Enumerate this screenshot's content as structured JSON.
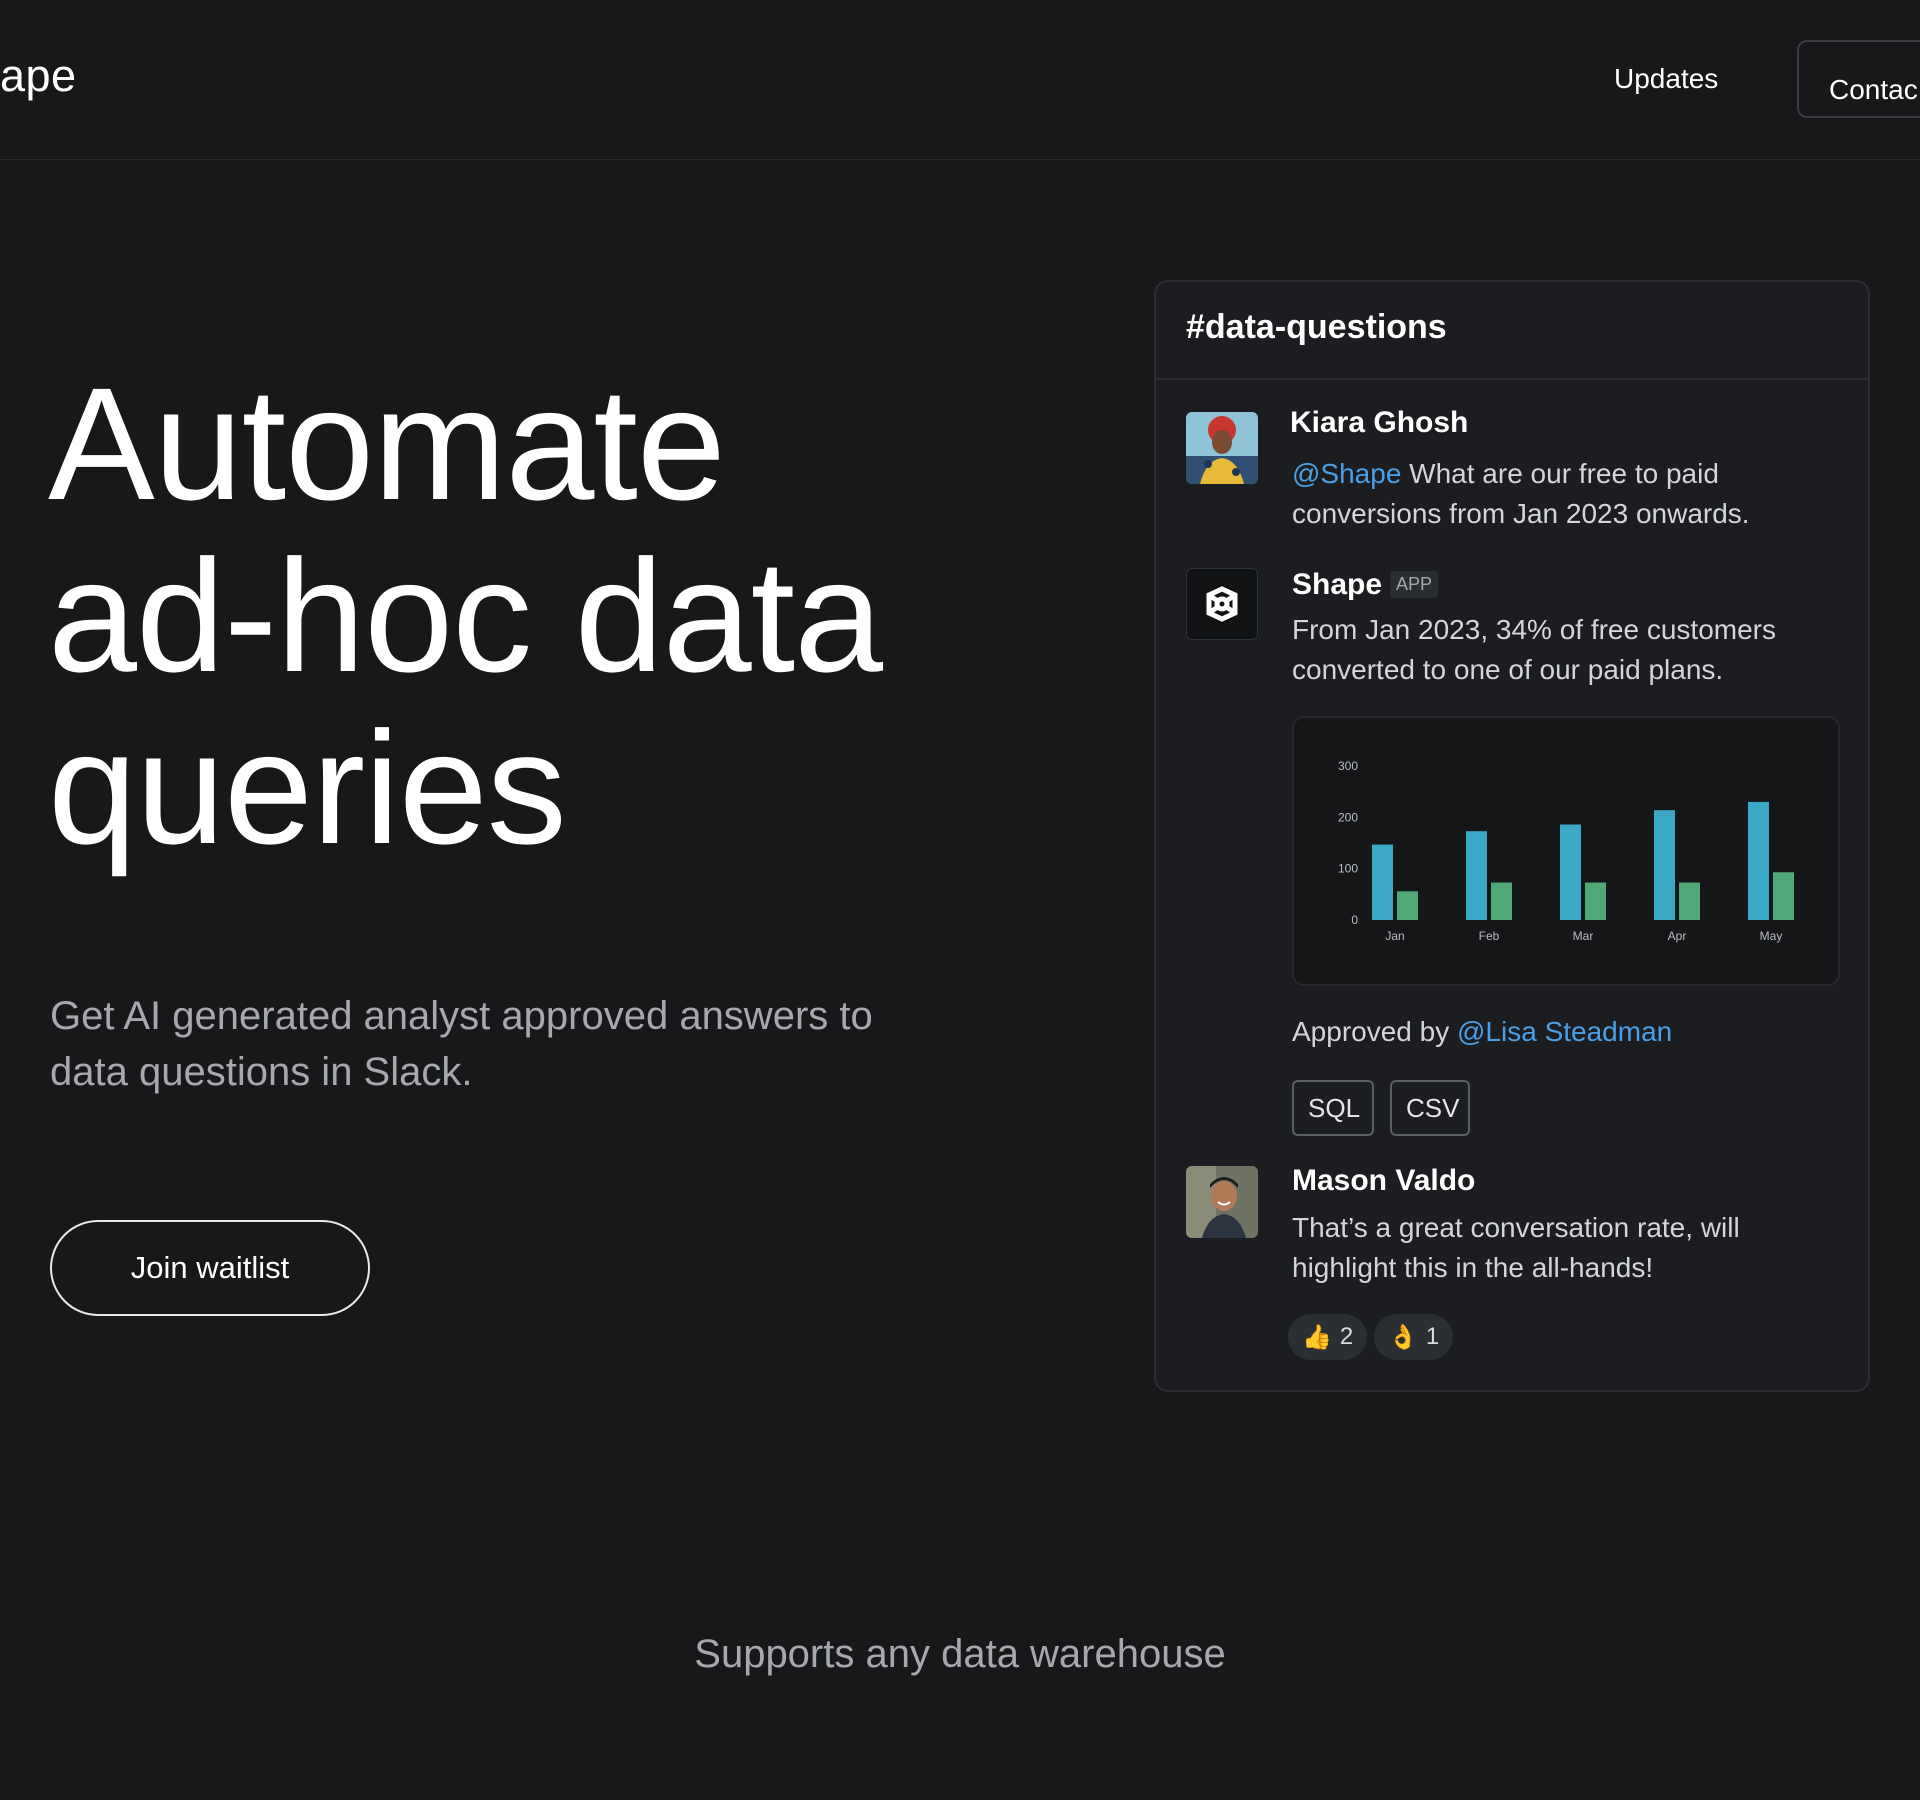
{
  "header": {
    "brand": "ape",
    "nav_updates": "Updates",
    "nav_contact": "Contac"
  },
  "hero": {
    "title_lines": [
      "Automate",
      "ad-hoc data",
      "queries"
    ],
    "subtitle_lines": [
      "Get AI generated analyst approved answers to",
      "data questions in Slack."
    ],
    "cta_label": "Join waitlist"
  },
  "slack_card": {
    "channel": "#data-questions",
    "message_1": {
      "author": "Kiara Ghosh",
      "mention": "@Shape",
      "text_line1": " What are our free to paid",
      "text_line2": "conversions from Jan 2023 onwards."
    },
    "message_2": {
      "author": "Shape",
      "badge": "APP",
      "text_line1": "From Jan 2023, 34% of free customers",
      "text_line2": "converted to one of our paid plans.",
      "approved_prefix": "Approved by ",
      "approved_mention": "@Lisa Steadman",
      "buttons": [
        "SQL",
        "CSV"
      ]
    },
    "message_3": {
      "author": "Mason Valdo",
      "text_line1": "That’s a great conversation rate, will",
      "text_line2": "highlight this in the all-hands!",
      "reactions": [
        {
          "emoji": "👍",
          "count": "2"
        },
        {
          "emoji": "👌",
          "count": "1"
        }
      ]
    }
  },
  "chart_data": {
    "type": "bar",
    "categories": [
      "Jan",
      "Feb",
      "Mar",
      "Apr",
      "May"
    ],
    "series": [
      {
        "values": [
          147,
          173,
          186,
          214,
          230
        ],
        "color": "#3ba8c6"
      },
      {
        "values": [
          56,
          73,
          73,
          73,
          93
        ],
        "color": "#4fa876"
      }
    ],
    "yticks": [
      "300",
      "200",
      "100",
      "0"
    ],
    "ylim": [
      0,
      300
    ],
    "title": "",
    "xlabel": "",
    "ylabel": ""
  },
  "footer": {
    "supports": "Supports any data warehouse"
  },
  "colors": {
    "background": "#171819",
    "card": "#1b1d20",
    "mention": "#4a9fe6",
    "muted_text": "#a6a8ab"
  },
  "icons": {
    "shape_logo": "shape-logo-icon"
  }
}
